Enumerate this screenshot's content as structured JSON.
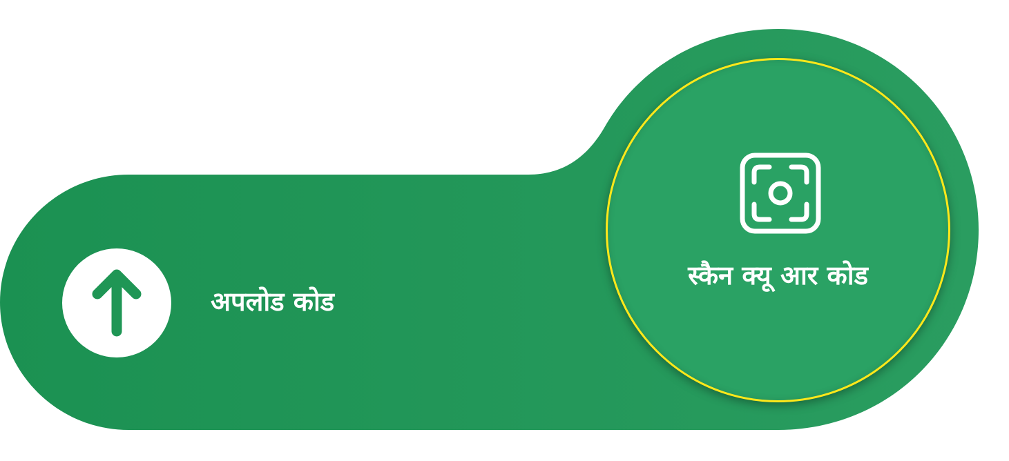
{
  "upload": {
    "label": "अपलोड कोड",
    "icon": "arrow-up-icon"
  },
  "scan": {
    "label": "स्कैन क्यू आर कोड",
    "icon": "scan-frame-icon"
  },
  "colors": {
    "background": "#ffffff",
    "shape_green": "#1f9655",
    "scan_green": "#2aa264",
    "ring_yellow": "#ffe81a",
    "text": "#ffffff"
  }
}
